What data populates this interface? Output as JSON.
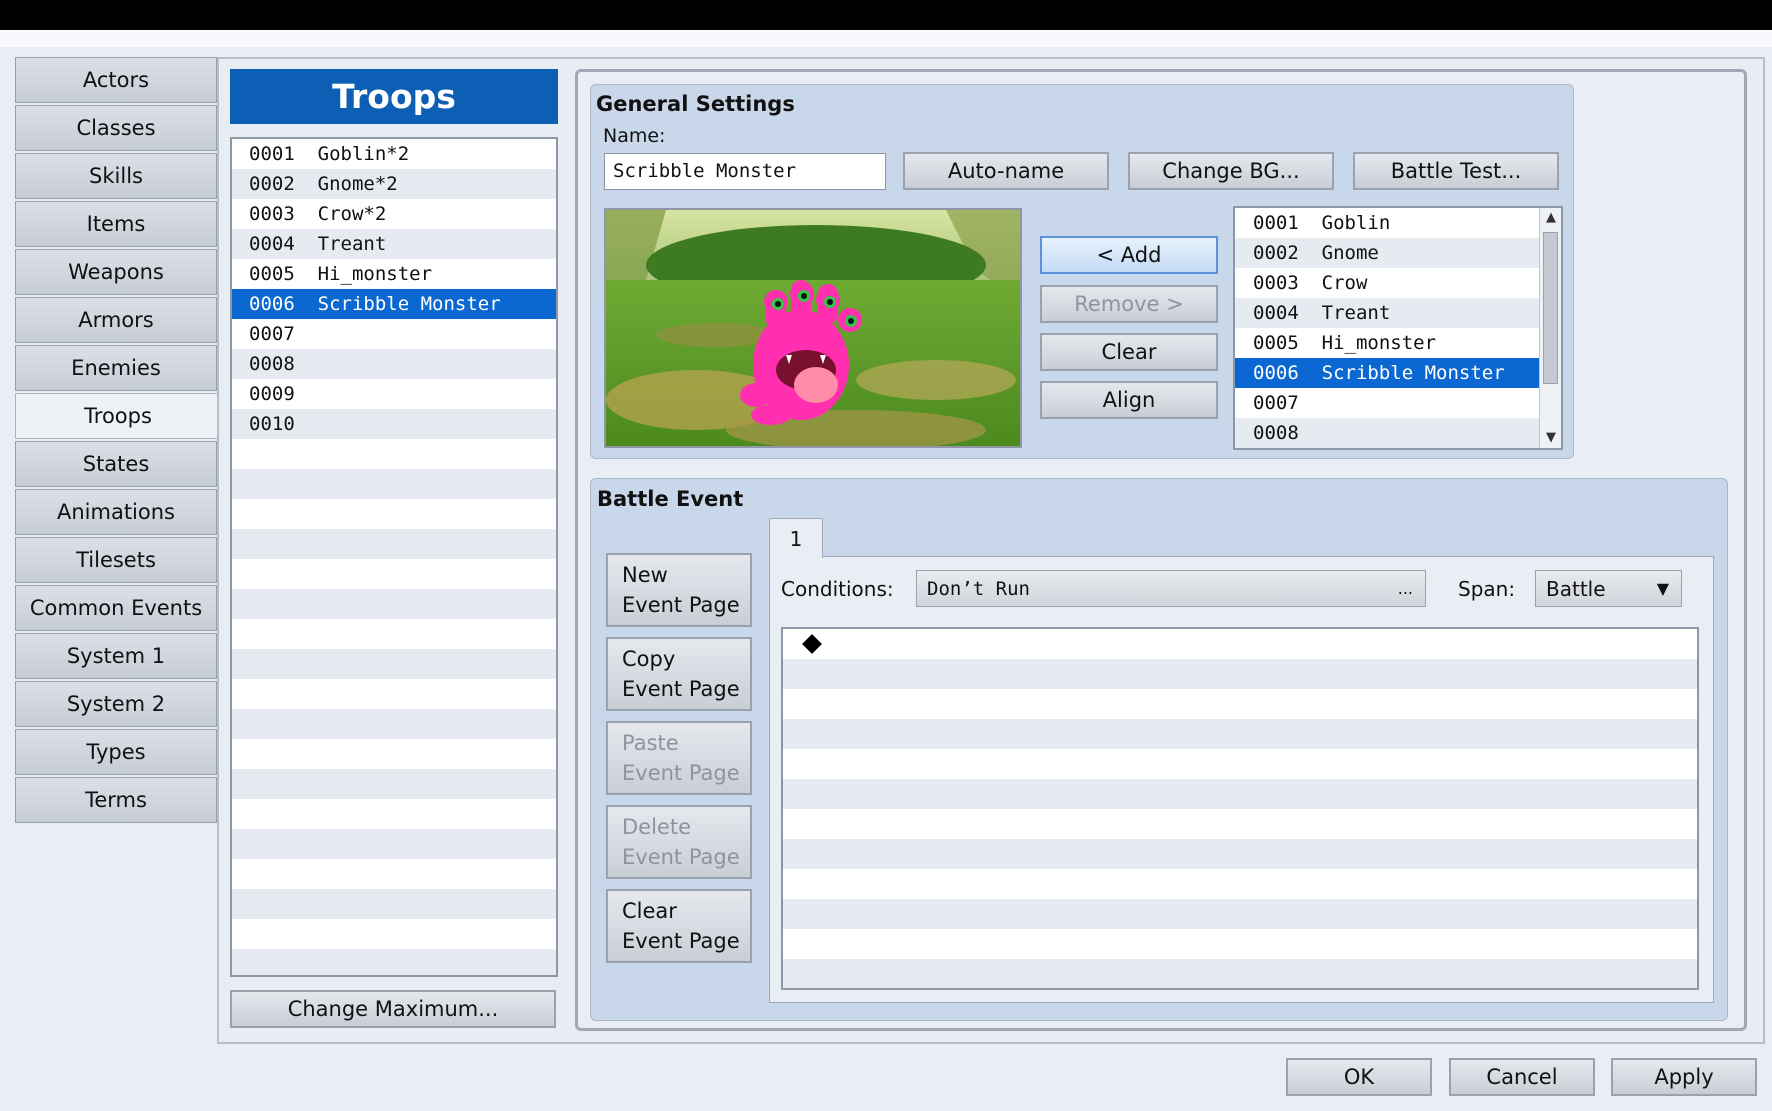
{
  "sidebar": {
    "items": [
      {
        "label": "Actors"
      },
      {
        "label": "Classes"
      },
      {
        "label": "Skills"
      },
      {
        "label": "Items"
      },
      {
        "label": "Weapons"
      },
      {
        "label": "Armors"
      },
      {
        "label": "Enemies"
      },
      {
        "label": "Troops"
      },
      {
        "label": "States"
      },
      {
        "label": "Animations"
      },
      {
        "label": "Tilesets"
      },
      {
        "label": "Common Events"
      },
      {
        "label": "System 1"
      },
      {
        "label": "System 2"
      },
      {
        "label": "Types"
      },
      {
        "label": "Terms"
      }
    ],
    "active": "Troops"
  },
  "troops": {
    "title": "Troops",
    "items": [
      "0001  Goblin*2",
      "0002  Gnome*2",
      "0003  Crow*2",
      "0004  Treant",
      "0005  Hi_monster",
      "0006  Scribble Monster",
      "0007",
      "0008",
      "0009",
      "0010"
    ],
    "selected": "0006  Scribble Monster",
    "change_max_label": "Change Maximum..."
  },
  "general": {
    "title": "General Settings",
    "name_label": "Name:",
    "name_value": "Scribble Monster",
    "autoname_label": "Auto-name",
    "change_bg_label": "Change BG...",
    "battle_test_label": "Battle Test...",
    "add_label": "< Add",
    "remove_label": "Remove >",
    "clear_label": "Clear",
    "align_label": "Align",
    "enemies": [
      "0001  Goblin",
      "0002  Gnome",
      "0003  Crow",
      "0004  Treant",
      "0005  Hi_monster",
      "0006  Scribble Monster",
      "0007",
      "0008"
    ],
    "selected_enemy": "0006  Scribble Monster"
  },
  "battle_event": {
    "title": "Battle Event",
    "tab_label": "1",
    "new_page": [
      "New",
      "Event Page"
    ],
    "copy_page": [
      "Copy",
      "Event Page"
    ],
    "paste_page": [
      "Paste",
      "Event Page"
    ],
    "delete_page": [
      "Delete",
      "Event Page"
    ],
    "clear_page": [
      "Clear",
      "Event Page"
    ],
    "conditions_label": "Conditions:",
    "conditions_value": "Don’t Run",
    "conditions_more": "...",
    "span_label": "Span:",
    "span_value": "Battle"
  },
  "footer": {
    "ok_label": "OK",
    "cancel_label": "Cancel",
    "apply_label": "Apply"
  },
  "colors": {
    "selection": "#0b67d1",
    "header": "#0c5fb4",
    "monster": "#ff2fb0"
  }
}
